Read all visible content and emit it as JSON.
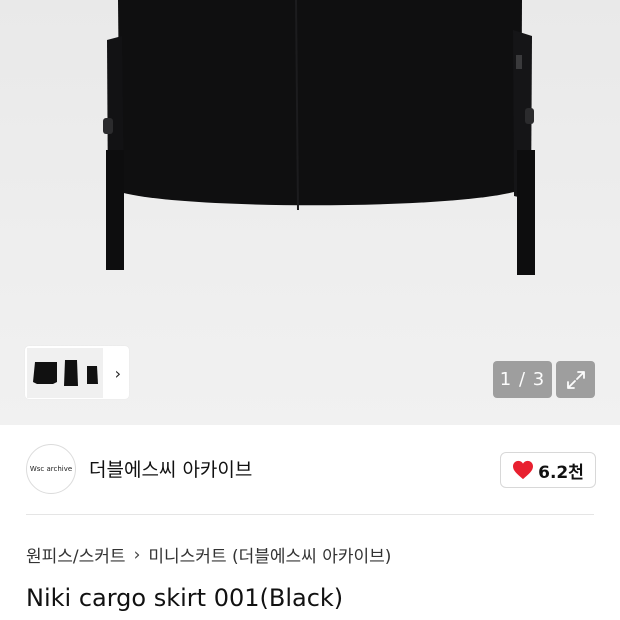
{
  "gallery": {
    "counter": "1 / 3",
    "thumbnails_count": 3,
    "expand_icon": "expand-icon",
    "chevron_icon": "chevron-right-icon"
  },
  "seller": {
    "avatar_text": "Wsc archive",
    "name": "더블에스씨 아카이브",
    "likes": "6.2천",
    "heart_color": "#e8202f"
  },
  "breadcrumb": {
    "category": "원피스/스커트",
    "subcategory": "미니스커트 (더블에스씨 아카이브)"
  },
  "product": {
    "title": "Niki cargo skirt 001(Black)"
  }
}
